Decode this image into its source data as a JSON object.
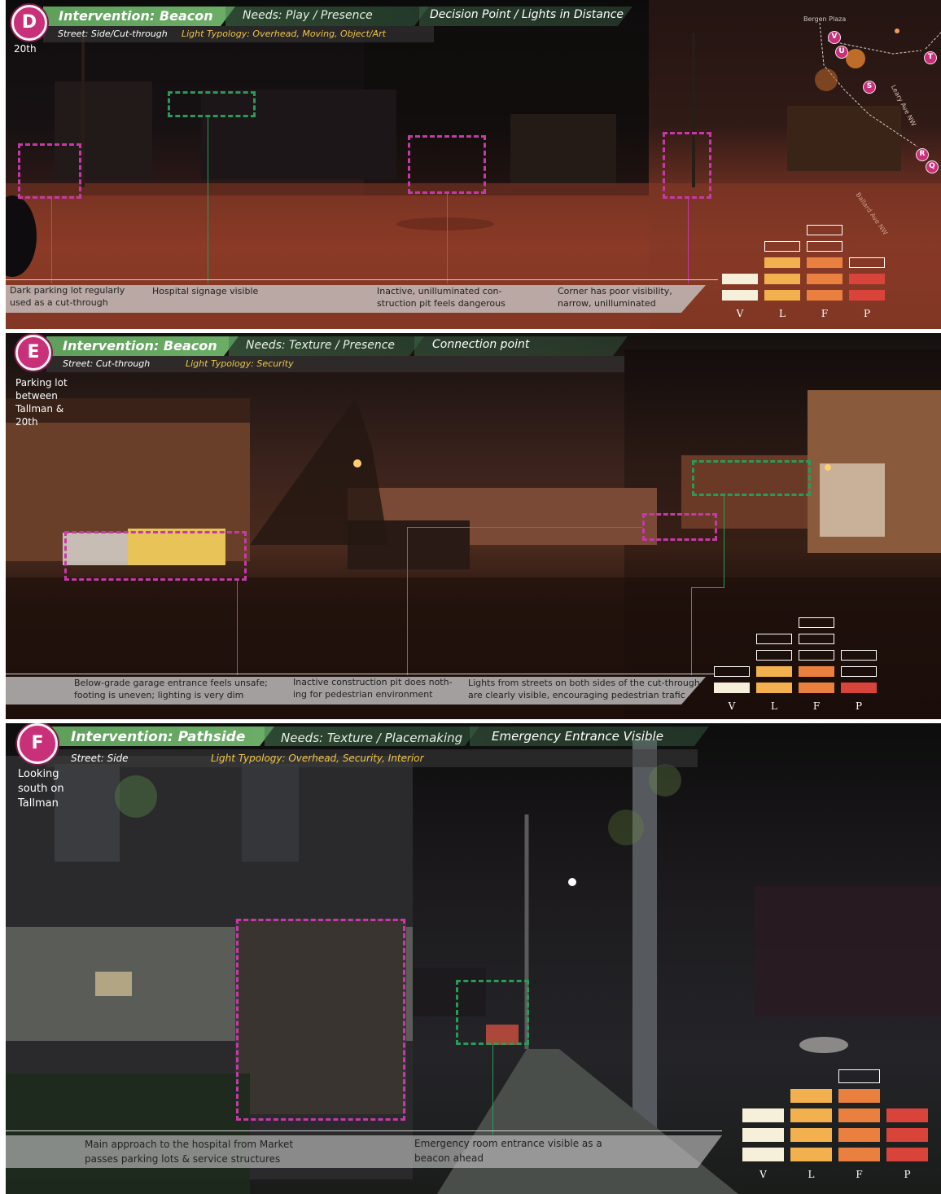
{
  "colors": {
    "badge": "#c8307a",
    "title_bar": "#62a35e",
    "marker_magenta": "#c53aa8",
    "marker_green": "#2a9a5a",
    "typology_text": "#f0c64a",
    "rating_V": "#f6efd9",
    "rating_L": "#f2b14e",
    "rating_F": "#e9803f",
    "rating_P": "#d8443a"
  },
  "panels": [
    {
      "badge": "D",
      "title": "Intervention: Beacon",
      "needs": "Needs: Play / Presence",
      "decision": "Decision Point / Lights in Distance",
      "street": "Street: Side/Cut-through",
      "typology": "Light Typology: Overhead, Moving, Object/Art",
      "location": "20th",
      "captions": [
        "Dark parking lot regularly used as a cut-through",
        "Hospital signage visible",
        "Inactive, unilluminated con- struction pit feels dangerous",
        "Corner has poor visibility, narrow, unilluminated"
      ],
      "map": {
        "title": "Bergen Plaza",
        "street1": "Leary Ave NW",
        "street2": "Ballard Ave NW",
        "markers": [
          "V",
          "U",
          "T",
          "S",
          "R",
          "Q"
        ]
      },
      "rating_axis": [
        "V",
        "L",
        "F",
        "P"
      ],
      "rating_levels": {
        "V": 2,
        "L": 3,
        "F": 3,
        "P": 2
      },
      "rating_outline_heights": {
        "V": 2,
        "L": 4,
        "F": 5,
        "P": 3
      }
    },
    {
      "badge": "E",
      "title": "Intervention: Beacon",
      "needs": "Needs: Texture / Presence",
      "decision": "Connection point",
      "street": "Street: Cut-through",
      "typology": "Light Typology: Security",
      "location": "Parking lot between Tallman & 20th",
      "captions": [
        "Below-grade garage entrance feels unsafe; footing is uneven; lighting is very dim",
        "Inactive construction pit does noth- ing for pedestrian environment",
        "Lights from streets on both sides of the cut-through are clearly visible, encouraging pedestrian trafic"
      ],
      "rating_axis": [
        "V",
        "L",
        "F",
        "P"
      ],
      "rating_levels": {
        "V": 1,
        "L": 2,
        "F": 2,
        "P": 1
      },
      "rating_outline_heights": {
        "V": 2,
        "L": 4,
        "F": 5,
        "P": 3
      }
    },
    {
      "badge": "F",
      "title": "Intervention: Pathside",
      "needs": "Needs: Texture / Placemaking",
      "decision": "Emergency Entrance Visible",
      "street": "Street: Side",
      "typology": "Light Typology: Overhead, Security, Interior",
      "location": "Looking south on Tallman",
      "captions": [
        "Main approach to the hospital from Market passes parking lots & service structures",
        "Emergency room entrance visible as a beacon ahead"
      ],
      "rating_axis": [
        "V",
        "L",
        "F",
        "P"
      ],
      "rating_levels": {
        "V": 3,
        "L": 4,
        "F": 4,
        "P": 3
      },
      "rating_outline_heights": {
        "V": 3,
        "L": 4,
        "F": 5,
        "P": 3
      }
    }
  ]
}
